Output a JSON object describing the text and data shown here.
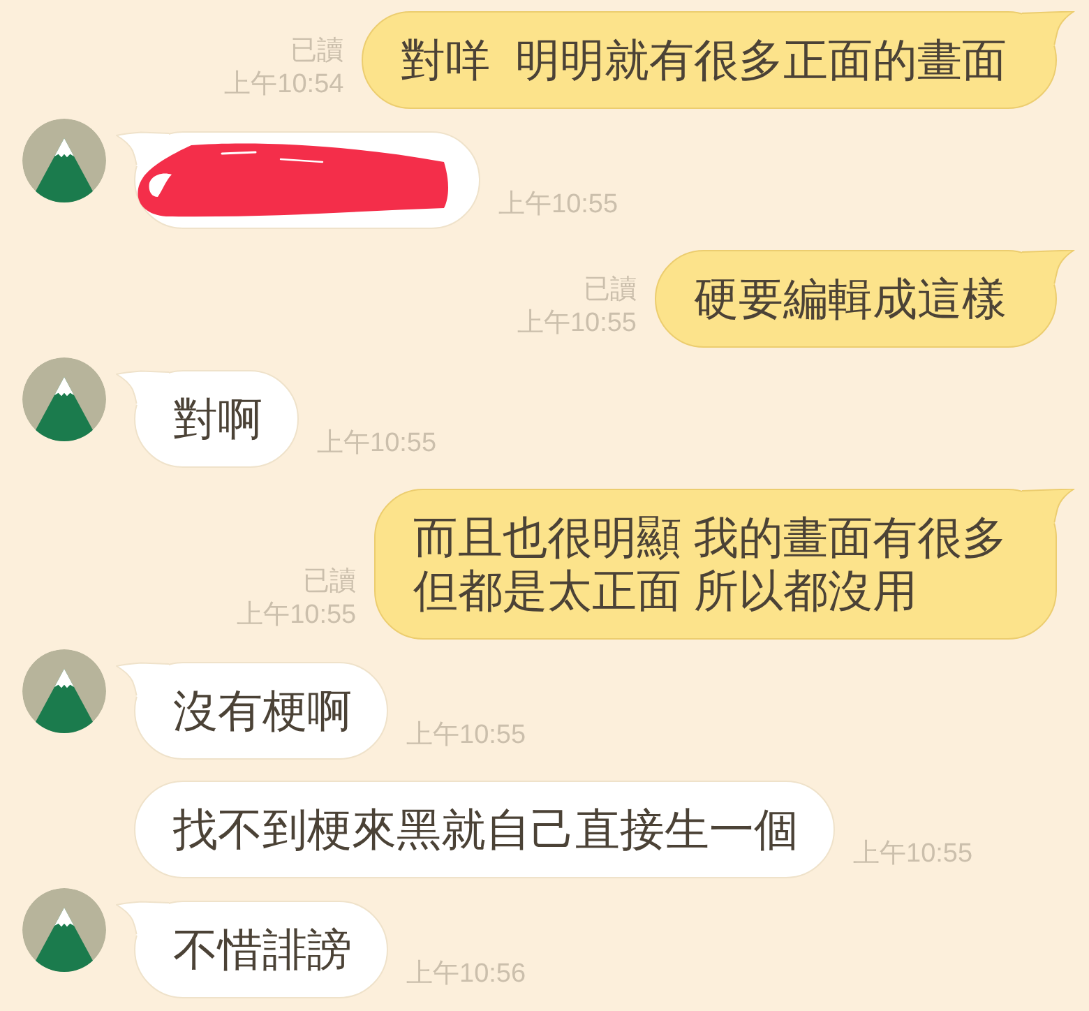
{
  "messages": [
    {
      "kind": "sent",
      "redacted": false,
      "lines": [
        "對咩  明明就有很多正面的畫面"
      ],
      "read_label": "已讀",
      "time": "上午10:54"
    },
    {
      "kind": "received",
      "redacted": true,
      "avatar": true,
      "time": "上午10:55"
    },
    {
      "kind": "sent",
      "redacted": false,
      "lines": [
        "硬要編輯成這樣"
      ],
      "read_label": "已讀",
      "time": "上午10:55"
    },
    {
      "kind": "received",
      "redacted": false,
      "avatar": true,
      "lines": [
        "對啊"
      ],
      "time": "上午10:55"
    },
    {
      "kind": "sent",
      "redacted": false,
      "lines": [
        "而且也很明顯 我的畫面有很多",
        "但都是太正面 所以都沒用"
      ],
      "read_label": "已讀",
      "time": "上午10:55"
    },
    {
      "kind": "received",
      "redacted": false,
      "avatar": true,
      "lines": [
        "沒有梗啊"
      ],
      "time": "上午10:55"
    },
    {
      "kind": "received",
      "redacted": false,
      "avatar": false,
      "lines": [
        "找不到梗來黑就自己直接生一個"
      ],
      "time": "上午10:55"
    },
    {
      "kind": "received",
      "redacted": false,
      "avatar": true,
      "lines": [
        "不惜誹謗"
      ],
      "time": "上午10:56"
    }
  ]
}
